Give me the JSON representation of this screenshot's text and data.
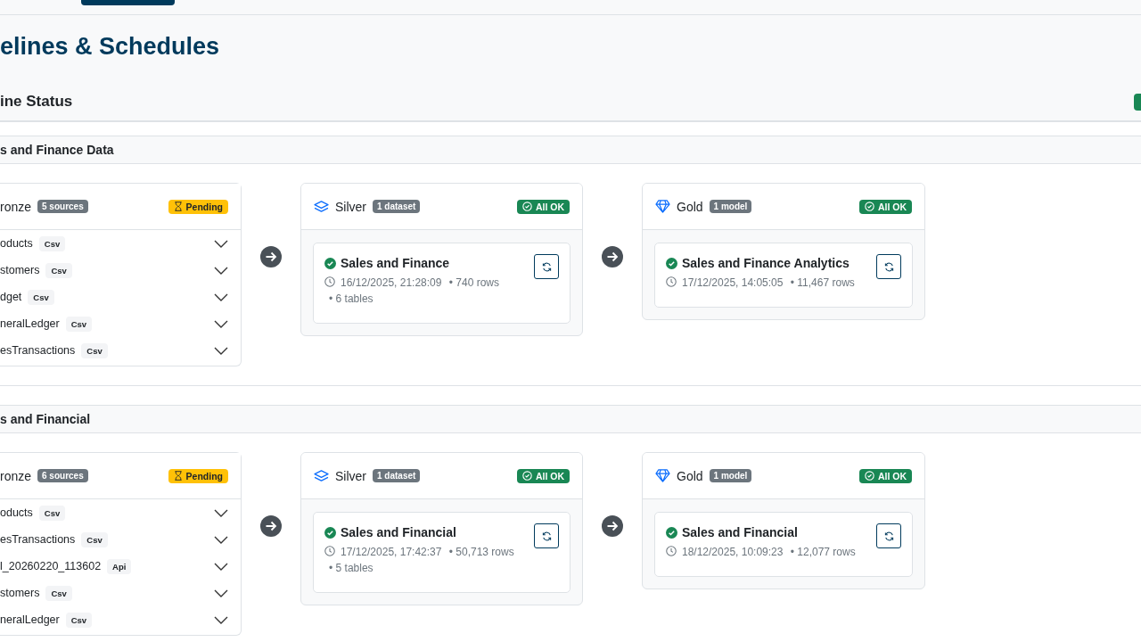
{
  "page_title": "elines & Schedules",
  "status_panel": {
    "title": "ine Status"
  },
  "pipelines": [
    {
      "name": "s and Finance Data",
      "bronze": {
        "label": "ronze",
        "count": "5 sources",
        "status": {
          "kind": "pending",
          "label": "Pending"
        },
        "sources": [
          {
            "name": "oducts",
            "type": "Csv",
            "expanded": false
          },
          {
            "name": "stomers",
            "type": "Csv",
            "expanded": false
          },
          {
            "name": "dget",
            "type": "Csv",
            "expanded": false
          },
          {
            "name": "neralLedger",
            "type": "Csv",
            "expanded": false
          },
          {
            "name": "esTransactions",
            "type": "Csv",
            "expanded": false
          }
        ]
      },
      "silver": {
        "label": "Silver",
        "count": "1 dataset",
        "status": {
          "kind": "ok",
          "label": "All OK"
        },
        "items": [
          {
            "name": "Sales and Finance",
            "ok": true,
            "timestamp": "16/12/2025, 21:28:09",
            "details": [
              "• 740 rows",
              "• 6 tables"
            ]
          }
        ]
      },
      "gold": {
        "label": "Gold",
        "count": "1 model",
        "status": {
          "kind": "ok",
          "label": "All OK"
        },
        "items": [
          {
            "name": "Sales and Finance Analytics",
            "ok": true,
            "timestamp": "17/12/2025, 14:05:05",
            "details": [
              "• 11,467 rows"
            ]
          }
        ]
      }
    },
    {
      "name": "s and Financial",
      "bronze": {
        "label": "ronze",
        "count": "6 sources",
        "status": {
          "kind": "pending",
          "label": "Pending"
        },
        "sources": [
          {
            "name": "oducts",
            "type": "Csv",
            "expanded": false
          },
          {
            "name": "esTransactions",
            "type": "Csv",
            "expanded": false
          },
          {
            "name": "l_20260220_113602",
            "type": "Api",
            "expanded": false
          },
          {
            "name": "stomers",
            "type": "Csv",
            "expanded": false
          },
          {
            "name": "neralLedger",
            "type": "Csv",
            "expanded": false
          }
        ]
      },
      "silver": {
        "label": "Silver",
        "count": "1 dataset",
        "status": {
          "kind": "ok",
          "label": "All OK"
        },
        "items": [
          {
            "name": "Sales and Financial",
            "ok": true,
            "timestamp": "17/12/2025, 17:42:37",
            "details": [
              "• 50,713 rows",
              "• 5 tables"
            ]
          }
        ]
      },
      "gold": {
        "label": "Gold",
        "count": "1 model",
        "status": {
          "kind": "ok",
          "label": "All OK"
        },
        "items": [
          {
            "name": "Sales and Financial",
            "ok": true,
            "timestamp": "18/12/2025, 10:09:23",
            "details": [
              "• 12,077 rows"
            ]
          }
        ]
      }
    }
  ]
}
